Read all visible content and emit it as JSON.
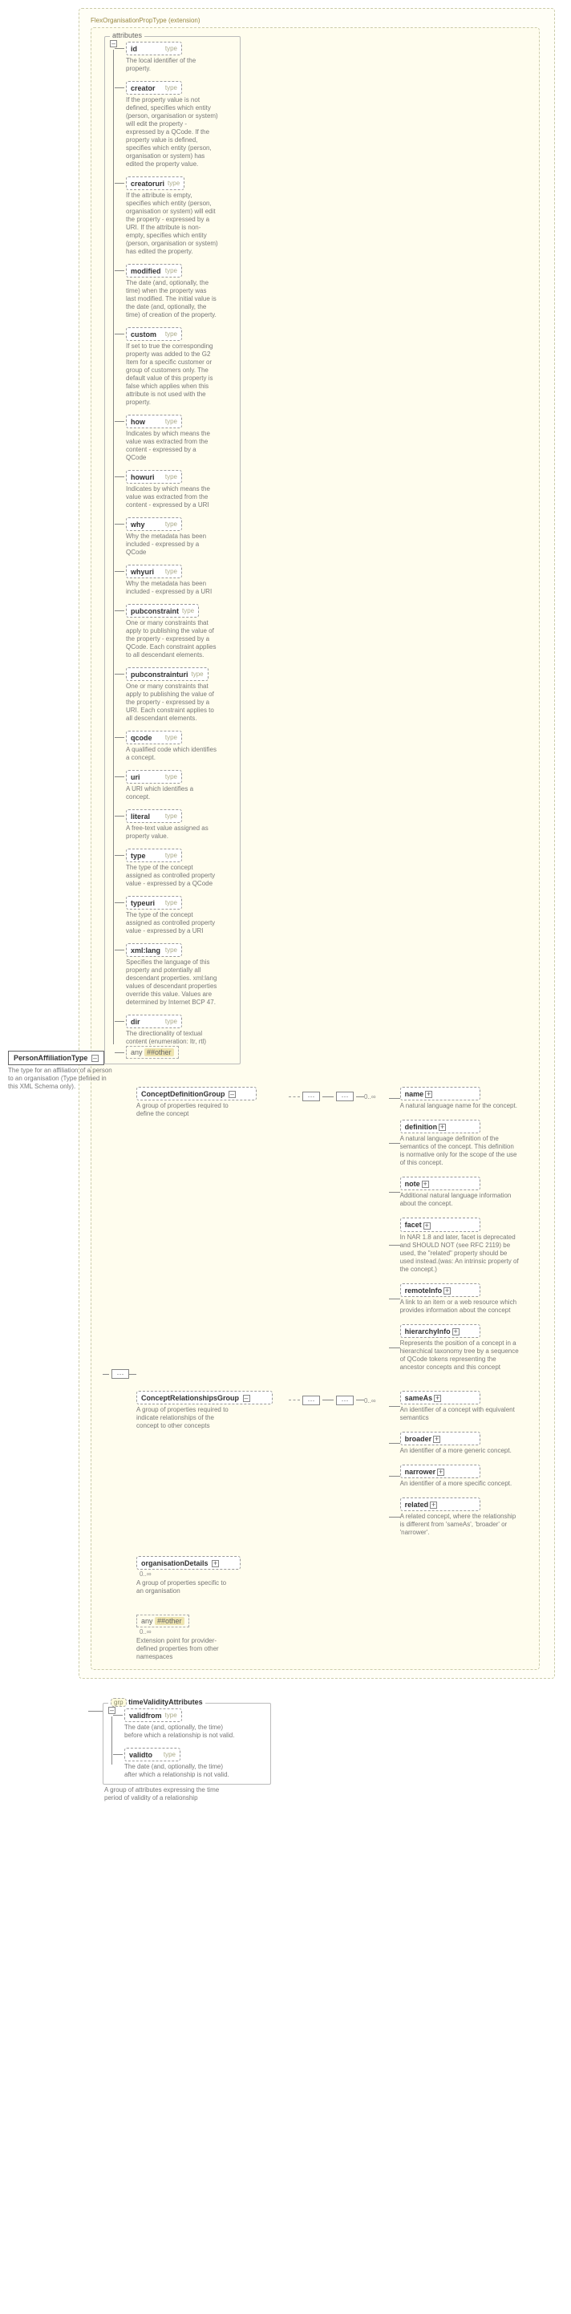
{
  "extension_title": "FlexOrganisationPropType (extension)",
  "root_type": {
    "name": "PersonAffiliationType",
    "desc": "The type for an affiliation of a person to an organisation (Type defined in this XML Schema only)."
  },
  "attributes_label": "attributes",
  "flex_attrs": [
    {
      "name": "id",
      "desc": "The local identifier of the property."
    },
    {
      "name": "creator",
      "desc": "If the property value is not defined, specifies which entity (person, organisation or system) will edit the property - expressed by a QCode. If the property value is defined, specifies which entity (person, organisation or system) has edited the property value."
    },
    {
      "name": "creatoruri",
      "desc": "If the attribute is empty, specifies which entity (person, organisation or system) will edit the property - expressed by a URI. If the attribute is non-empty, specifies which entity (person, organisation or system) has edited the property."
    },
    {
      "name": "modified",
      "desc": "The date (and, optionally, the time) when the property was last modified. The initial value is the date (and, optionally, the time) of creation of the property."
    },
    {
      "name": "custom",
      "desc": "If set to true the corresponding property was added to the G2 Item for a specific customer or group of customers only. The default value of this property is false which applies when this attribute is not used with the property."
    },
    {
      "name": "how",
      "desc": "Indicates by which means the value was extracted from the content - expressed by a QCode"
    },
    {
      "name": "howuri",
      "desc": "Indicates by which means the value was extracted from the content - expressed by a URI"
    },
    {
      "name": "why",
      "desc": "Why the metadata has been included - expressed by a QCode"
    },
    {
      "name": "whyuri",
      "desc": "Why the metadata has been included - expressed by a URI"
    },
    {
      "name": "pubconstraint",
      "desc": "One or many constraints that apply to publishing the value of the property - expressed by a QCode. Each constraint applies to all descendant elements."
    },
    {
      "name": "pubconstrainturi",
      "desc": "One or many constraints that apply to publishing the value of the property - expressed by a URI. Each constraint applies to all descendant elements."
    },
    {
      "name": "qcode",
      "desc": "A qualified code which identifies a concept."
    },
    {
      "name": "uri",
      "desc": "A URI which identifies a concept."
    },
    {
      "name": "literal",
      "desc": "A free-text value assigned as property value."
    },
    {
      "name": "type",
      "desc": "The type of the concept assigned as controlled property value - expressed by a QCode"
    },
    {
      "name": "typeuri",
      "desc": "The type of the concept assigned as controlled property value - expressed by a URI"
    },
    {
      "name": "xml:lang",
      "desc": "Specifies the language of this property and potentially all descendant properties. xml:lang values of descendant properties override this value. Values are determined by Internet BCP 47."
    },
    {
      "name": "dir",
      "desc": "The directionality of textual content (enumeration: ltr, rtl)"
    }
  ],
  "any_label1": "##other",
  "any_word": "any",
  "concept_def": {
    "title": "ConceptDefinitionGroup",
    "desc": "A group of properties required to define the concept",
    "card": "0..∞",
    "children": [
      {
        "name": "name",
        "desc": "A natural language name for the concept."
      },
      {
        "name": "definition",
        "desc": "A natural language definition of the semantics of the concept. This definition is normative only for the scope of the use of this concept."
      },
      {
        "name": "note",
        "desc": "Additional natural language information about the concept."
      },
      {
        "name": "facet",
        "desc": "In NAR 1.8 and later, facet is deprecated and SHOULD NOT (see RFC 2119) be used, the \"related\" property should be used instead.(was: An intrinsic property of the concept.)"
      },
      {
        "name": "remoteInfo",
        "desc": "A link to an item or a web resource which provides information about the concept"
      },
      {
        "name": "hierarchyInfo",
        "desc": "Represents the position of a concept in a hierarchical taxonomy tree by a sequence of QCode tokens representing the ancestor concepts and this concept"
      }
    ]
  },
  "concept_rel": {
    "title": "ConceptRelationshipsGroup",
    "desc": "A group of properties required to indicate relationships of the concept to other concepts",
    "card": "0..∞",
    "children": [
      {
        "name": "sameAs",
        "desc": "An identifier of a concept with equivalent semantics"
      },
      {
        "name": "broader",
        "desc": "An identifier of a more generic concept."
      },
      {
        "name": "narrower",
        "desc": "An identifier of a more specific concept."
      },
      {
        "name": "related",
        "desc": "A related concept, where the relationship is different from 'sameAs', 'broader' or 'narrower'."
      }
    ]
  },
  "org_details": {
    "name": "organisationDetails",
    "desc": "A group of properties specific to an organisation",
    "card": "0..∞"
  },
  "ext_point": {
    "label": "##other",
    "desc": "Extension point for provider-defined properties from other namespaces",
    "card": "0..∞"
  },
  "time_validity": {
    "title": "timeValidityAttributes",
    "grp_label": "grp",
    "desc": "A group of attributes expressing the time period of validity of a relationship",
    "attrs": [
      {
        "name": "validfrom",
        "desc": "The date (and, optionally, the time) before which a relationship is not valid."
      },
      {
        "name": "validto",
        "desc": "The date (and, optionally, the time) after which a relationship is not valid."
      }
    ]
  }
}
